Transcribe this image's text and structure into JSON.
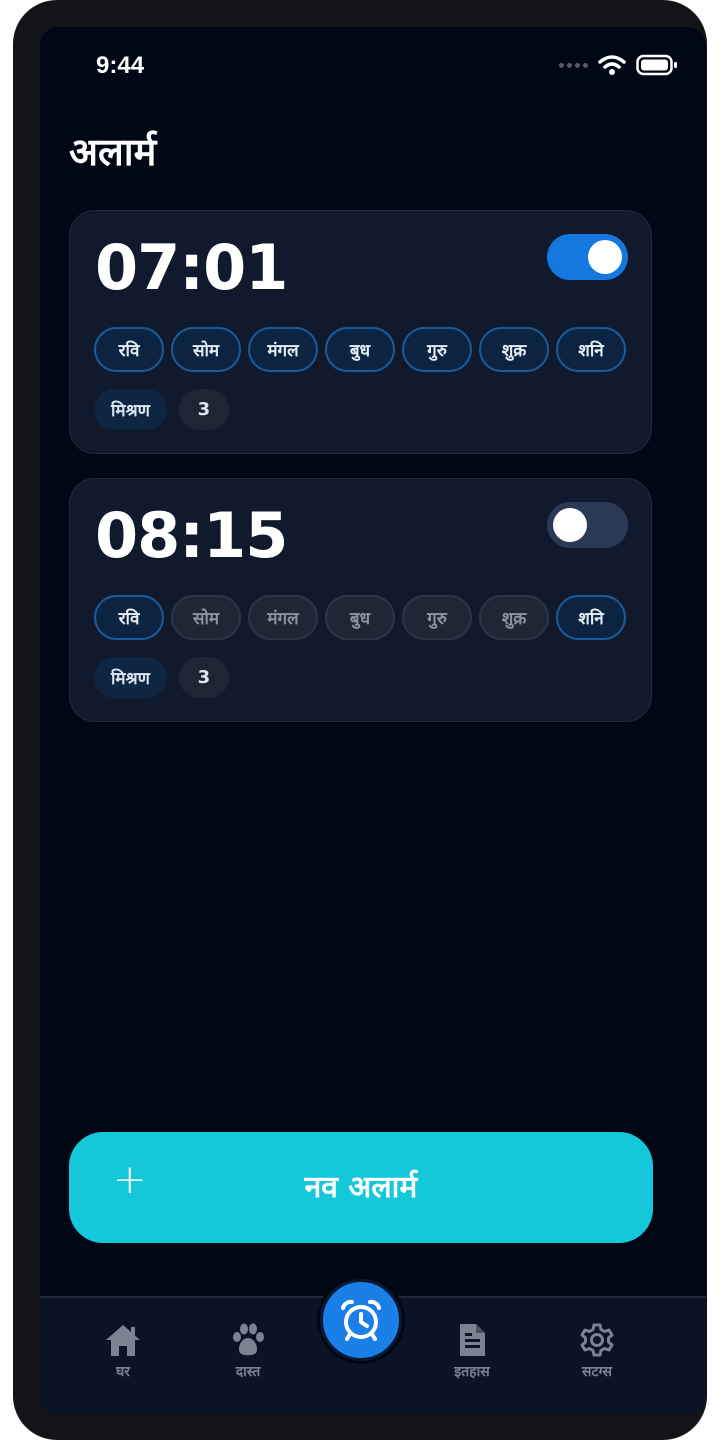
{
  "status_bar": {
    "time": "9:44"
  },
  "page": {
    "title": "अलार्म"
  },
  "alarms": [
    {
      "time": "07:01",
      "enabled": true,
      "days": [
        {
          "label": "रवि",
          "active": true
        },
        {
          "label": "सोम",
          "active": true
        },
        {
          "label": "मंगल",
          "active": true
        },
        {
          "label": "बुध",
          "active": true
        },
        {
          "label": "गुरु",
          "active": true
        },
        {
          "label": "शुक्र",
          "active": true
        },
        {
          "label": "शनि",
          "active": true
        }
      ],
      "mode": "मिश्रण",
      "count": "3"
    },
    {
      "time": "08:15",
      "enabled": false,
      "days": [
        {
          "label": "रवि",
          "active": true
        },
        {
          "label": "सोम",
          "active": false
        },
        {
          "label": "मंगल",
          "active": false
        },
        {
          "label": "बुध",
          "active": false
        },
        {
          "label": "गुरु",
          "active": false
        },
        {
          "label": "शुक्र",
          "active": false
        },
        {
          "label": "शनि",
          "active": true
        }
      ],
      "mode": "मिश्रण",
      "count": "3"
    }
  ],
  "new_alarm_button": {
    "icon": "plus-icon",
    "label": "नव अलार्म"
  },
  "nav": {
    "home": {
      "icon": "home-icon",
      "label": "घर"
    },
    "friends": {
      "icon": "paw-icon",
      "label": "दास्त"
    },
    "alarm": {
      "icon": "alarm-clock-icon"
    },
    "history": {
      "icon": "document-icon",
      "label": "इतहास"
    },
    "settings": {
      "icon": "gear-icon",
      "label": "सटग्स"
    }
  },
  "colors": {
    "background": "#010714",
    "card": "#111a2c",
    "toggle_on": "#1478e0",
    "accent_button": "#14c8da",
    "fab": "#1a80e8"
  }
}
